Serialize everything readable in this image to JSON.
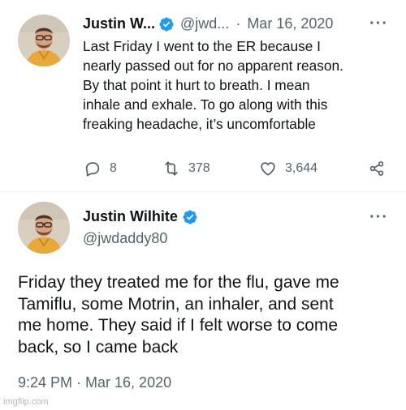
{
  "tweet1": {
    "display_name": "Justin W...",
    "handle": "@jwd...",
    "separator": "·",
    "date": "Mar 16, 2020",
    "lines": [
      "Last Friday I went to the ER because I",
      "nearly passed out for no apparent reason.",
      "By that point it hurt to breath. I mean",
      "inhale and exhale. To go along with this",
      "freaking headache, it’s uncomfortable"
    ],
    "actions": {
      "replies": "8",
      "retweets": "378",
      "likes": "3,644"
    }
  },
  "tweet2": {
    "display_name": "Justin Wilhite",
    "handle": "@jwdaddy80",
    "lines": [
      "Friday they treated me for the flu, gave me",
      "Tamiflu, some Motrin, an inhaler, and sent",
      "me home. They said if I felt worse to come",
      "back, so I came back"
    ],
    "timestamp": "9:24 PM · Mar 16, 2020"
  },
  "more_label": "···",
  "watermark": "imgflip.com",
  "colors": {
    "verified": "#1d9bf0",
    "muted": "#536471",
    "text": "#0f1419"
  },
  "icons": [
    "verified-badge-icon",
    "reply-icon",
    "retweet-icon",
    "like-icon",
    "share-icon",
    "more-icon"
  ]
}
